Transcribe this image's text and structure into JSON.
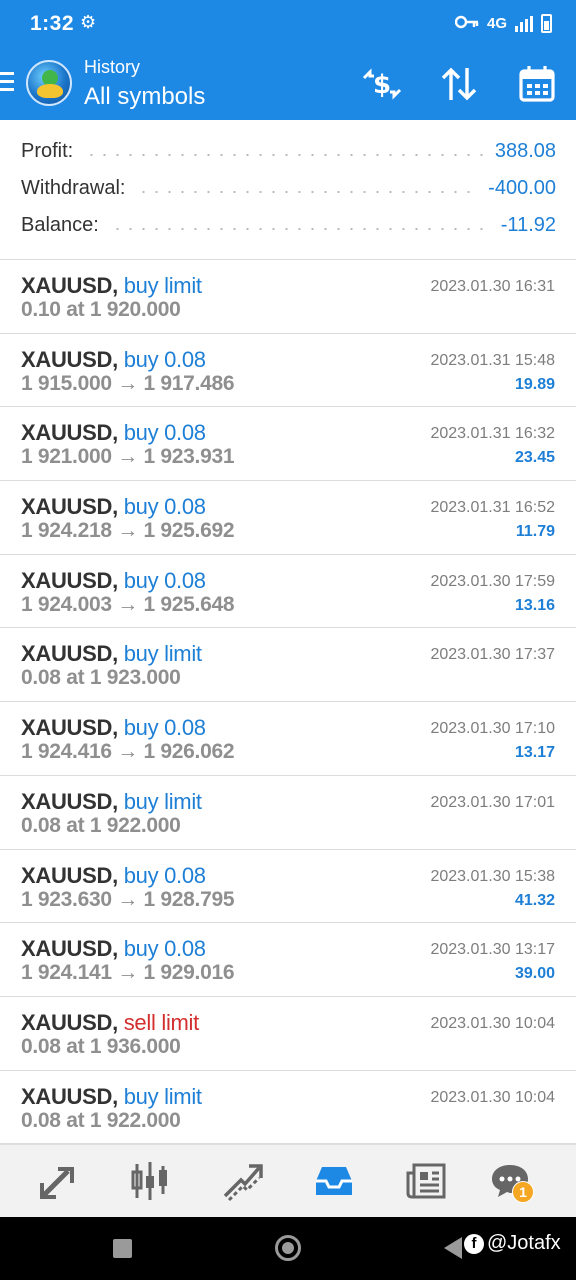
{
  "status_bar": {
    "time": "1:32",
    "network": "4G"
  },
  "app_bar": {
    "subtitle": "History",
    "title": "All symbols"
  },
  "summary": {
    "profit_label": "Profit:",
    "profit_value": "388.08",
    "withdrawal_label": "Withdrawal:",
    "withdrawal_value": "-400.00",
    "balance_label": "Balance:",
    "balance_value": "-11.92"
  },
  "deals": [
    {
      "symbol": "XAUUSD",
      "action": "buy limit",
      "action_type": "buy",
      "detail": "0.10 at 1 920.000",
      "time": "2023.01.30 16:31",
      "profit": ""
    },
    {
      "symbol": "XAUUSD",
      "action": "buy 0.08",
      "action_type": "buy",
      "detail": "1 915.000 → 1 917.486",
      "time": "2023.01.31 15:48",
      "profit": "19.89"
    },
    {
      "symbol": "XAUUSD",
      "action": "buy 0.08",
      "action_type": "buy",
      "detail": "1 921.000 → 1 923.931",
      "time": "2023.01.31 16:32",
      "profit": "23.45"
    },
    {
      "symbol": "XAUUSD",
      "action": "buy 0.08",
      "action_type": "buy",
      "detail": "1 924.218 → 1 925.692",
      "time": "2023.01.31 16:52",
      "profit": "11.79"
    },
    {
      "symbol": "XAUUSD",
      "action": "buy 0.08",
      "action_type": "buy",
      "detail": "1 924.003 → 1 925.648",
      "time": "2023.01.30 17:59",
      "profit": "13.16"
    },
    {
      "symbol": "XAUUSD",
      "action": "buy limit",
      "action_type": "buy",
      "detail": "0.08 at 1 923.000",
      "time": "2023.01.30 17:37",
      "profit": ""
    },
    {
      "symbol": "XAUUSD",
      "action": "buy 0.08",
      "action_type": "buy",
      "detail": "1 924.416 → 1 926.062",
      "time": "2023.01.30 17:10",
      "profit": "13.17"
    },
    {
      "symbol": "XAUUSD",
      "action": "buy limit",
      "action_type": "buy",
      "detail": "0.08 at 1 922.000",
      "time": "2023.01.30 17:01",
      "profit": ""
    },
    {
      "symbol": "XAUUSD",
      "action": "buy 0.08",
      "action_type": "buy",
      "detail": "1 923.630 → 1 928.795",
      "time": "2023.01.30 15:38",
      "profit": "41.32"
    },
    {
      "symbol": "XAUUSD",
      "action": "buy 0.08",
      "action_type": "buy",
      "detail": "1 924.141 → 1 929.016",
      "time": "2023.01.30 13:17",
      "profit": "39.00"
    },
    {
      "symbol": "XAUUSD",
      "action": "sell limit",
      "action_type": "sell",
      "detail": "0.08 at 1 936.000",
      "time": "2023.01.30 10:04",
      "profit": ""
    },
    {
      "symbol": "XAUUSD",
      "action": "buy limit",
      "action_type": "buy",
      "detail": "0.08 at 1 922.000",
      "time": "2023.01.30 10:04",
      "profit": ""
    }
  ],
  "bottom_nav": {
    "items": [
      {
        "icon": "quotes-icon"
      },
      {
        "icon": "chart-icon"
      },
      {
        "icon": "trade-icon"
      },
      {
        "icon": "history-icon",
        "active": true
      },
      {
        "icon": "news-icon"
      },
      {
        "icon": "messages-icon",
        "badge": "1"
      }
    ]
  },
  "watermark": {
    "text": "@Jotafx"
  },
  "colors": {
    "primary": "#1e88e5",
    "value_blue": "#1e7fd6",
    "sell_red": "#d32f2f",
    "badge": "#f5a623"
  }
}
